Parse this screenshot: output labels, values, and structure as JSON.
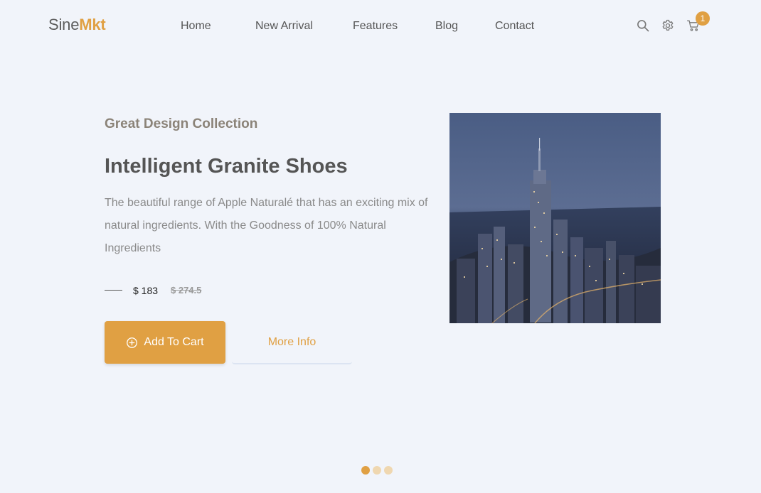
{
  "brand": {
    "part1": "Sine",
    "part2": "Mkt"
  },
  "nav": {
    "items": [
      "Home",
      "New Arrival",
      "Features",
      "Blog",
      "Contact"
    ]
  },
  "header": {
    "icons": [
      "search-icon",
      "settings-icon",
      "cart-icon"
    ],
    "cart_count": "1"
  },
  "hero": {
    "eyebrow": "Great Design Collection",
    "title": "Intelligent Granite Shoes",
    "description": "The beautiful range of Apple Naturalé that has an exciting mix of natural ingredients. With the Goodness of 100% Natural Ingredients",
    "price": "$ 183",
    "old_price": "$ 274.5",
    "add_to_cart_label": "Add To Cart",
    "more_info_label": "More Info",
    "image_icon": "city-skyline-image"
  },
  "slider": {
    "total": 3,
    "active": 1
  },
  "colors": {
    "accent": "#e0a043",
    "background": "#f1f4fa",
    "text": "#555555",
    "muted": "#8a8a8a",
    "dot_inactive": "#efd7b0"
  }
}
